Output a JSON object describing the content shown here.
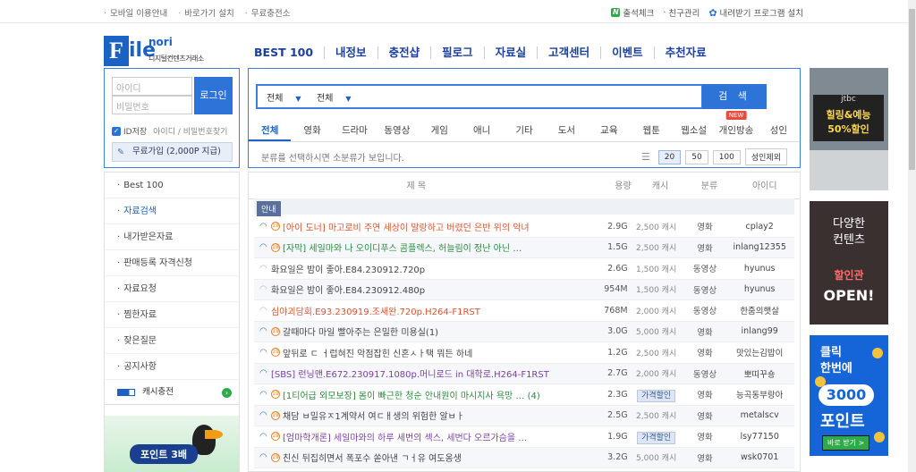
{
  "topbar": {
    "links": [
      "모바일 이용안내",
      "바로가기 설치",
      "무료충전소"
    ],
    "right": [
      "출석체크",
      "친구관리",
      "내려받기 프로그램 설치"
    ]
  },
  "logo": {
    "f": "F",
    "ile": "ile",
    "nori": "nori",
    "sub": "디지털컨텐츠거래소"
  },
  "nav": [
    "BEST 100",
    "내정보",
    "충전샵",
    "필로그",
    "자료실",
    "고객센터",
    "이벤트",
    "추천자료"
  ],
  "login": {
    "id_placeholder": "아이디",
    "pw_placeholder": "비밀번호",
    "button": "로그인",
    "remember": "ID저장",
    "find": "아이디 / 비밀번호찾기",
    "join": "무료가입 (2,000P 지급)"
  },
  "search": {
    "select1": "전체",
    "select2": "전체",
    "button": "검 색",
    "categories": [
      "전체",
      "영화",
      "드라마",
      "동영상",
      "게임",
      "애니",
      "기타",
      "도서",
      "교육",
      "웹툰",
      "웹소설",
      "개인방송",
      "성인"
    ],
    "new_badge": "NEW",
    "hint": "분류를 선택하시면 소분류가 보입니다.",
    "view_counts": [
      "20",
      "50",
      "100"
    ],
    "adult_button": "성인제외"
  },
  "sidemenu": {
    "items": [
      "Best 100",
      "자료검색",
      "내가받은자료",
      "판매등록 자격신청",
      "자료요청",
      "찜한자료",
      "잦은질문",
      "공지사항"
    ],
    "charge": "캐시충전",
    "banner": "포인트 3배"
  },
  "results": {
    "headers": [
      "제 목",
      "용량",
      "캐시",
      "분류",
      "아이디"
    ],
    "notice": "안내",
    "rows": [
      {
        "title": "[아이 도너] 마고로비 주연 세상이 말랑하고 버렸던 은반 위의 악녀",
        "size": "2.9G",
        "cash": "2,500 캐시",
        "cat": "영화",
        "uid": "cplay2",
        "color": "#d9532c",
        "wifi": true,
        "badge": true,
        "discount": false
      },
      {
        "title": "[자막] 세일마와 나 오이디푸스 콤플렉스, 허늘림이 정난 아닌 …",
        "size": "1.5G",
        "cash": "2,500 캐시",
        "cat": "영화",
        "uid": "inlang12355",
        "color": "#2b8a3e",
        "wifi": true,
        "badge": true,
        "discount": false
      },
      {
        "title": "화요일은 밤이 좋아.E84.230912.720p",
        "size": "2.6G",
        "cash": "1,500 캐시",
        "cat": "동영상",
        "uid": "hyunus",
        "color": "#444",
        "wifi": false,
        "badge": false,
        "discount": false
      },
      {
        "title": "화요일은 밤이 좋아.E84.230912.480p",
        "size": "954M",
        "cash": "1,500 캐시",
        "cat": "동영상",
        "uid": "hyunus",
        "color": "#444",
        "wifi": false,
        "badge": false,
        "discount": false
      },
      {
        "title": "심야괴담회.E93.230919.조새완.720p.H264-F1RST",
        "size": "768M",
        "cash": "2,000 캐시",
        "cat": "동영상",
        "uid": "한줌의햇살",
        "color": "#d9532c",
        "wifi": false,
        "badge": false,
        "discount": false
      },
      {
        "title": "갈때마다 마일 빨아주는 은밀한 미용실(1)",
        "size": "3.0G",
        "cash": "5,000 캐시",
        "cat": "영화",
        "uid": "inlang99",
        "color": "#444",
        "wifi": true,
        "badge": true,
        "discount": false
      },
      {
        "title": "앞뒤로 ㄷ ㅓ럽혀진 악점잡힌 신혼ㅅㅏ택 뭐든 하네",
        "size": "1.2G",
        "cash": "2,500 캐시",
        "cat": "영화",
        "uid": "맛있는김밥이",
        "color": "#444",
        "wifi": true,
        "badge": true,
        "discount": false
      },
      {
        "title": "[SBS] 런닝맨.E672.230917.1080p.머니로드 in 대학로.H264-F1RST",
        "size": "2.7G",
        "cash": "2,000 캐시",
        "cat": "동영상",
        "uid": "뽀띠꾸숑",
        "color": "#7b3fa0",
        "wifi": true,
        "badge": false,
        "discount": false
      },
      {
        "title": "[1티어급 외모보장] 몸이 빠근한 청순 안내원이 마시지사 욕망 … (4)",
        "size": "2.3G",
        "cash": "가격할인",
        "cat": "영화",
        "uid": "능곡동부랑아",
        "color": "#2b8a3e",
        "wifi": true,
        "badge": true,
        "discount": true
      },
      {
        "title": "채담 ㅂ밀유ㅈ1계약서 여ㄷㅐ생의 위험한 알ㅂㅏ",
        "size": "2.5G",
        "cash": "2,500 캐시",
        "cat": "영화",
        "uid": "metalscv",
        "color": "#444",
        "wifi": true,
        "badge": true,
        "discount": false
      },
      {
        "title": "[엄마학개론] 세일마와의 하루 세번의 섹스, 세번다 오르가슴을 …",
        "size": "1.9G",
        "cash": "가격할인",
        "cat": "영화",
        "uid": "lsy77150",
        "color": "#7b3fa0",
        "wifi": true,
        "badge": true,
        "discount": true
      },
      {
        "title": "친신 뒤집히면서 폭포수 쏟아낸 ㄱㅓ유 여도옹생",
        "size": "3.2G",
        "cash": "5,000 캐시",
        "cat": "영화",
        "uid": "wsk0701",
        "color": "#444",
        "wifi": true,
        "badge": true,
        "discount": false
      }
    ]
  },
  "ads": {
    "ad1": {
      "brand": "jtbc",
      "l1": "힐링&예능",
      "l2": "50%할인"
    },
    "ad2": {
      "a": "다양한",
      "b": "컨텐츠",
      "c": "할인관",
      "d": "OPEN!"
    },
    "ad3": {
      "a": "클릭",
      "b": "한번에",
      "c": "3000",
      "d": "포인트",
      "e": "바로 받기 >"
    }
  },
  "colors": {
    "accent": "#2d73d8",
    "nav": "#1b3fa0"
  }
}
